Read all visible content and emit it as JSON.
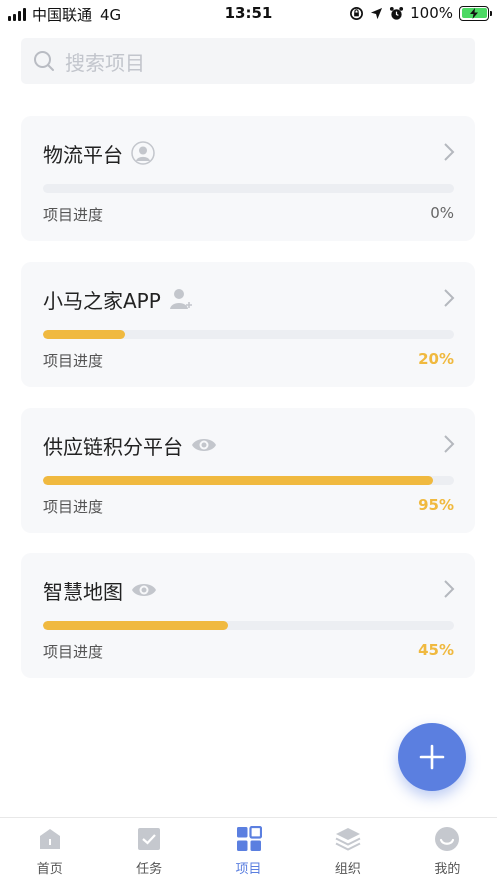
{
  "status_bar": {
    "carrier": "中国联通",
    "network": "4G",
    "time": "13:51",
    "battery": "100%"
  },
  "search": {
    "placeholder": "搜索项目"
  },
  "projects": [
    {
      "name": "物流平台",
      "status_icon": "user-circle-icon",
      "progress_label": "项目进度",
      "progress_text": "0%",
      "progress": 0
    },
    {
      "name": "小马之家APP",
      "status_icon": "add-user-icon",
      "progress_label": "项目进度",
      "progress_text": "20%",
      "progress": 20
    },
    {
      "name": "供应链积分平台",
      "status_icon": "eye-icon",
      "progress_label": "项目进度",
      "progress_text": "95%",
      "progress": 95
    },
    {
      "name": "智慧地图",
      "status_icon": "eye-icon",
      "progress_label": "项目进度",
      "progress_text": "45%",
      "progress": 45
    }
  ],
  "fab": {
    "icon": "plus-icon"
  },
  "tabs": [
    {
      "label": "首页",
      "icon": "home-icon"
    },
    {
      "label": "任务",
      "icon": "task-check-icon"
    },
    {
      "label": "项目",
      "icon": "grid-icon",
      "active": true
    },
    {
      "label": "组织",
      "icon": "layers-icon"
    },
    {
      "label": "我的",
      "icon": "profile-icon"
    }
  ],
  "colors": {
    "accent": "#5b7fe0",
    "progress": "#f0b93f",
    "card_bg": "#f7f8fa",
    "track": "#eceef2"
  }
}
